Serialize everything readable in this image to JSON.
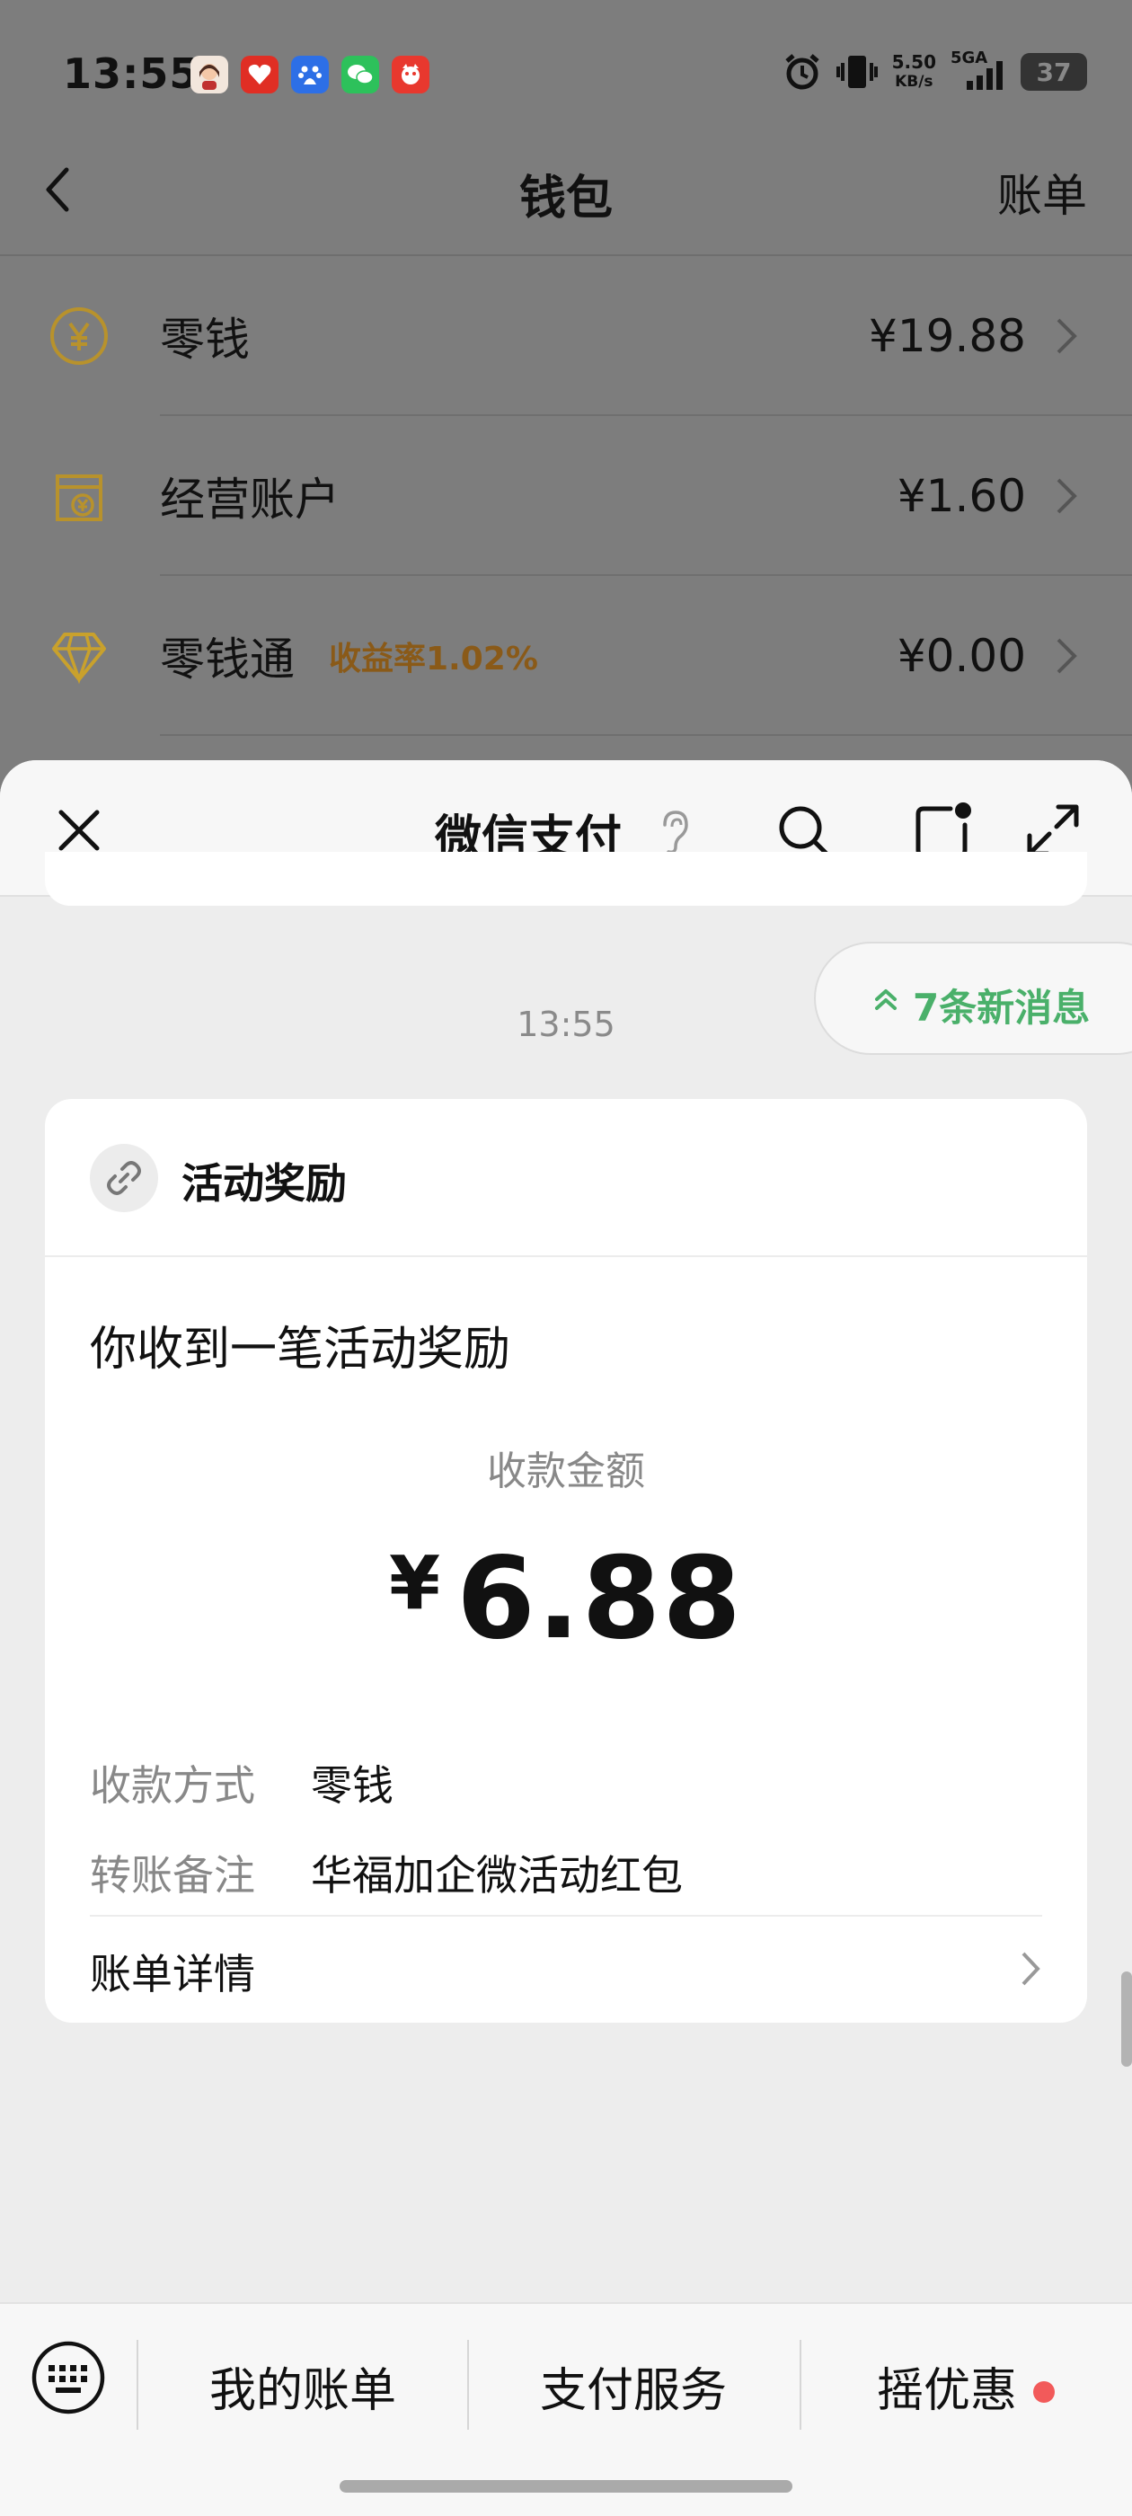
{
  "status_bar": {
    "time": "13:55",
    "speed_value": "5.50",
    "speed_unit": "KB/s",
    "network": "5GA",
    "battery": "37"
  },
  "wallet": {
    "title": "钱包",
    "bill_link": "账单",
    "rows": [
      {
        "label": "零钱",
        "sub": "",
        "amount": "¥19.88"
      },
      {
        "label": "经营账户",
        "sub": "",
        "amount": "¥1.60"
      },
      {
        "label": "零钱通",
        "sub": "收益率1.02%",
        "amount": "¥0.00"
      }
    ]
  },
  "sheet": {
    "title": "微信支付",
    "new_messages": "7条新消息",
    "message_time": "13:55"
  },
  "card": {
    "source": "活动奖励",
    "heading": "你收到一笔活动奖励",
    "amount_label": "收款金额",
    "currency": "¥",
    "amount": "6.88",
    "method_label": "收款方式",
    "method_value": "零钱",
    "remark_label": "转账备注",
    "remark_value": "华福加企微活动红包",
    "detail_link": "账单详情"
  },
  "bottom_menu": {
    "items": [
      "我的账单",
      "支付服务",
      "摇优惠"
    ]
  },
  "colors": {
    "accent_green": "#4ab06a",
    "gold": "#c9a12c",
    "notification_red": "#f25a5a"
  }
}
